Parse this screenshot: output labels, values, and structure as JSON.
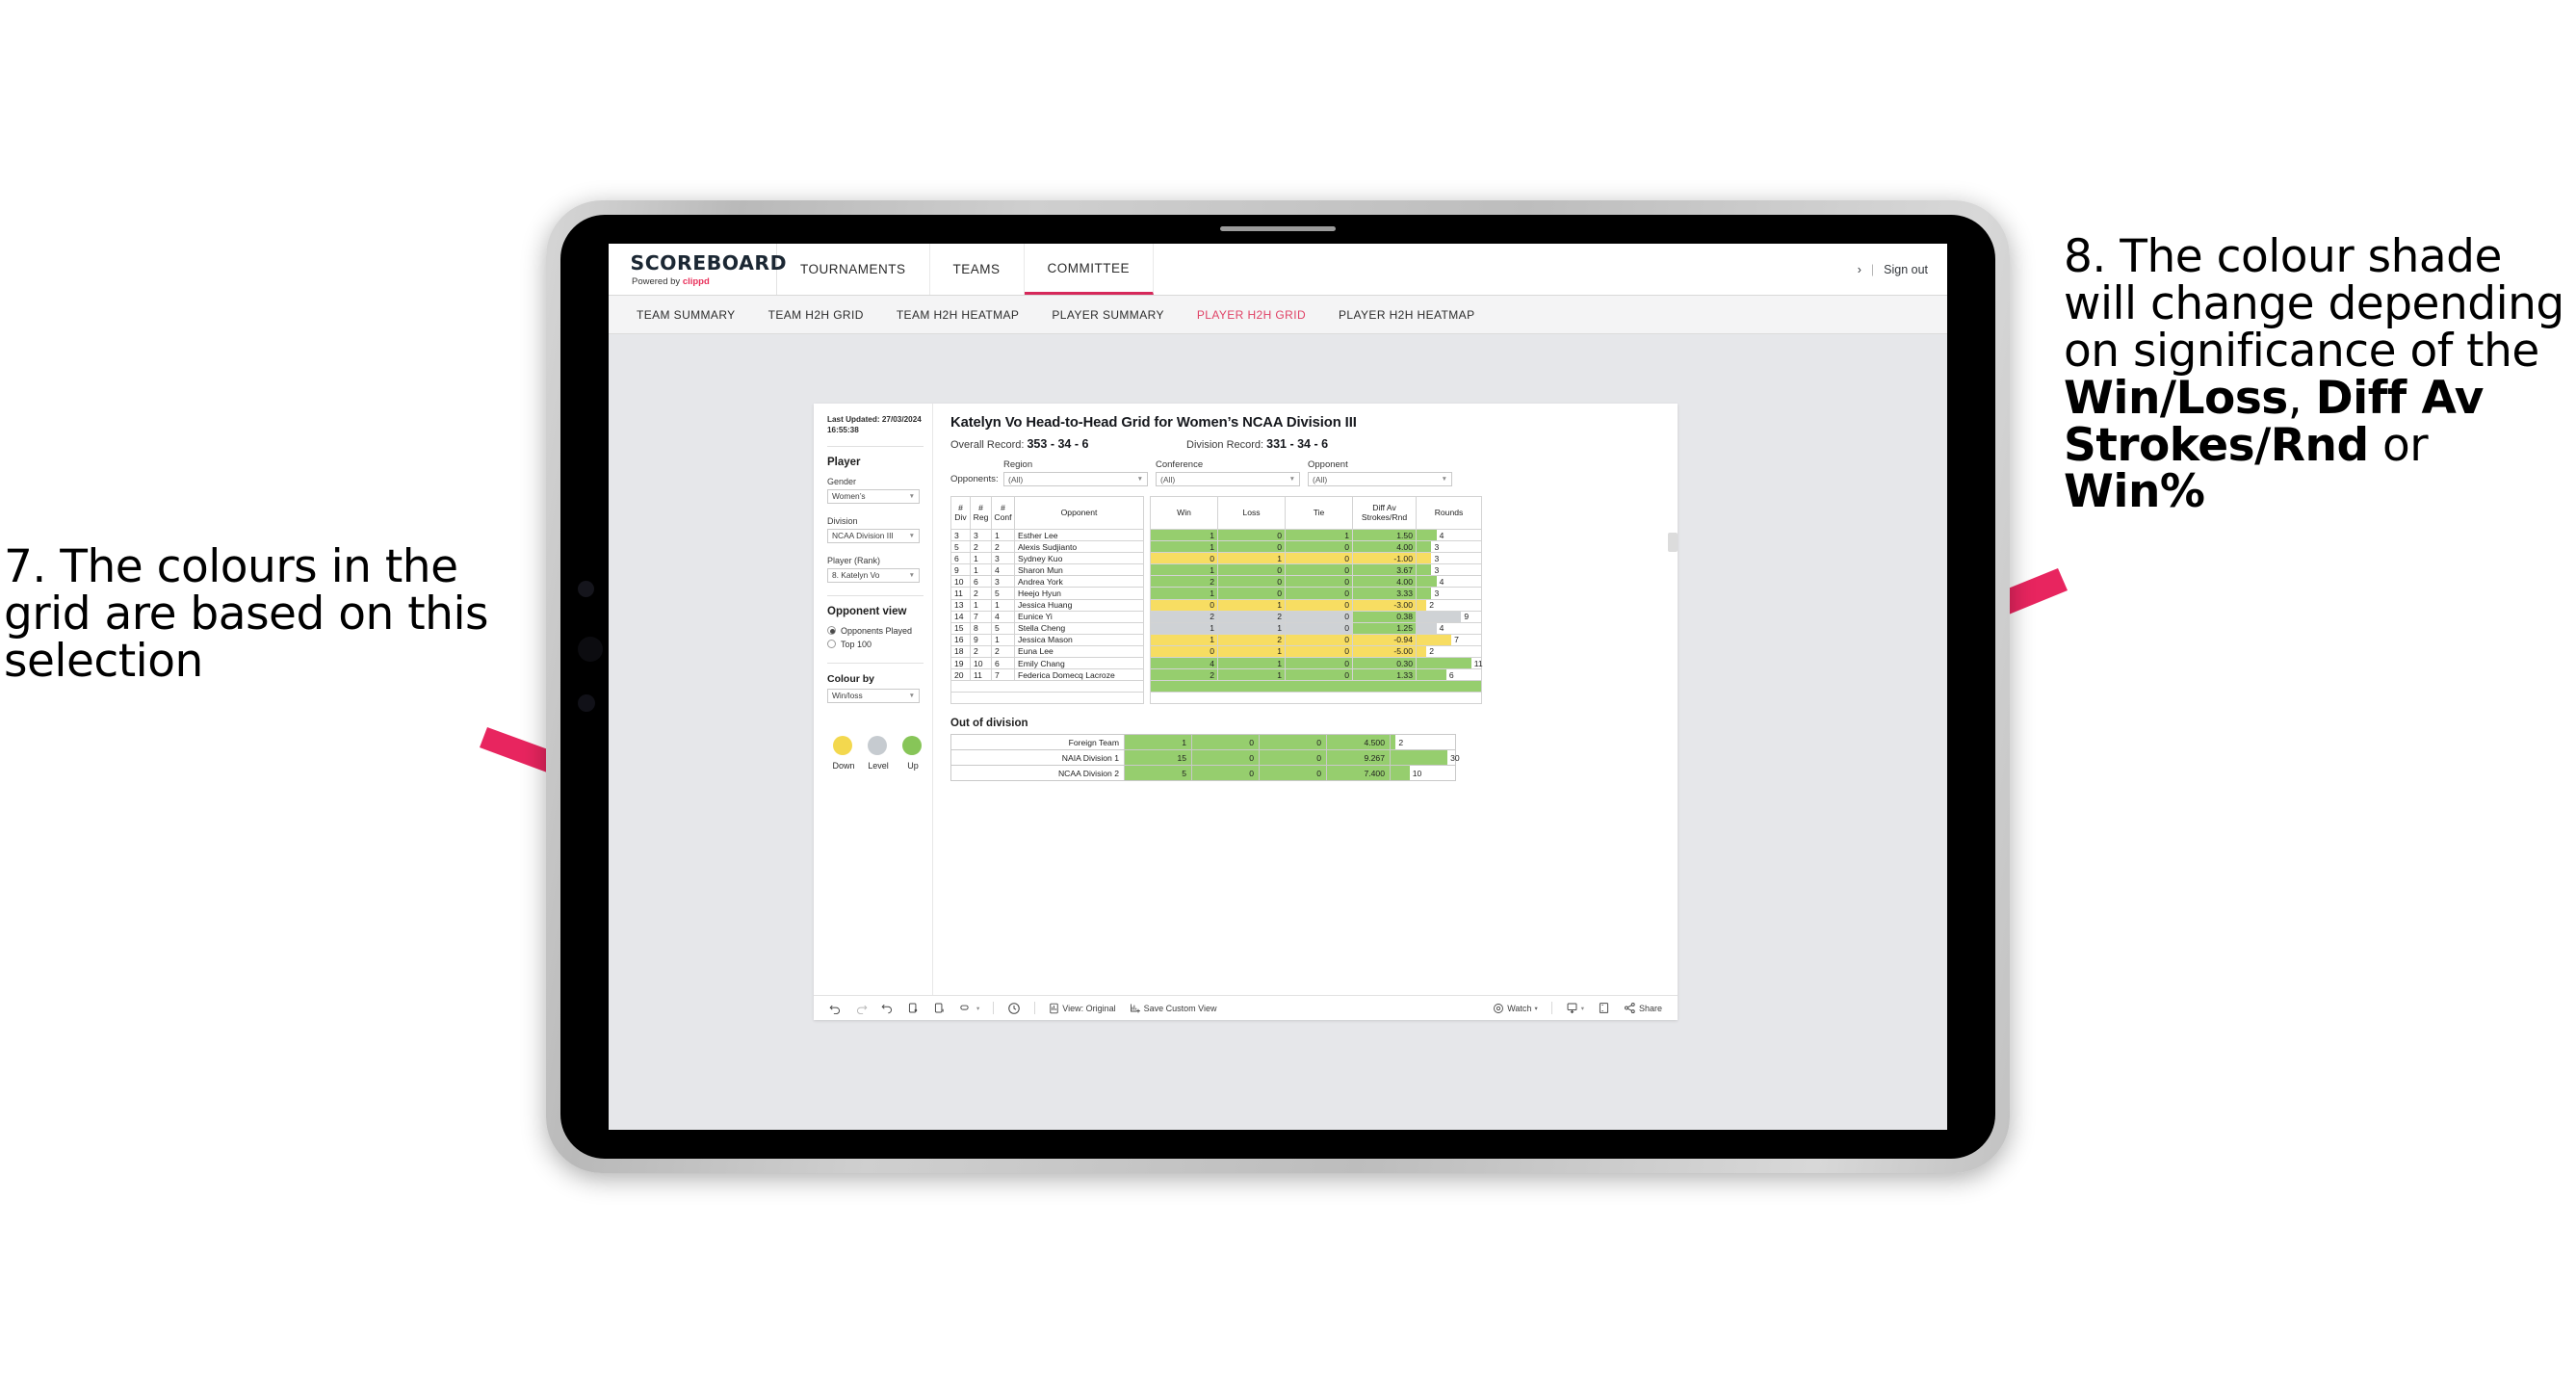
{
  "annotations": {
    "left": "7. The colours in the grid are based on this selection",
    "right_pre": "8. The colour shade will change depending on significance of the ",
    "right_b1": "Win/Loss",
    "right_mid1": ", ",
    "right_b2": "Diff Av Strokes/Rnd",
    "right_mid2": " or ",
    "right_b3": "Win%",
    "arrow_color": "#e8255f"
  },
  "app": {
    "logo": "SCOREBOARD",
    "logo_sub_prefix": "Powered by ",
    "logo_brand": "clippd",
    "top_nav": [
      {
        "label": "TOURNAMENTS",
        "active": false
      },
      {
        "label": "TEAMS",
        "active": false
      },
      {
        "label": "COMMITTEE",
        "active": true
      }
    ],
    "signout_chevron": "›",
    "signout_sep": "|",
    "signout": "Sign out",
    "sub_nav": [
      {
        "label": "TEAM SUMMARY",
        "active": false
      },
      {
        "label": "TEAM H2H GRID",
        "active": false
      },
      {
        "label": "TEAM H2H HEATMAP",
        "active": false
      },
      {
        "label": "PLAYER SUMMARY",
        "active": false
      },
      {
        "label": "PLAYER H2H GRID",
        "active": true
      },
      {
        "label": "PLAYER H2H HEATMAP",
        "active": false
      }
    ],
    "accent": "#d6285a"
  },
  "sidebar": {
    "last_updated_line1": "Last Updated: 27/03/2024",
    "last_updated_line2": "16:55:38",
    "player_heading": "Player",
    "gender_label": "Gender",
    "gender_value": "Women’s",
    "division_label": "Division",
    "division_value": "NCAA Division III",
    "player_rank_label": "Player (Rank)",
    "player_rank_value": "8. Katelyn Vo",
    "opponent_view_heading": "Opponent view",
    "opponent_view_options": [
      {
        "label": "Opponents Played",
        "selected": true
      },
      {
        "label": "Top 100",
        "selected": false
      }
    ],
    "colour_by_label": "Colour by",
    "colour_by_value": "Win/loss",
    "legend": [
      {
        "label": "Down",
        "color": "#f3d84e"
      },
      {
        "label": "Level",
        "color": "#c6cbd0"
      },
      {
        "label": "Up",
        "color": "#87c558"
      }
    ]
  },
  "panel": {
    "title": "Katelyn Vo Head-to-Head Grid for Women’s NCAA Division III",
    "overall_record_label": "Overall Record: ",
    "overall_record_value": "353 -  34 - 6",
    "division_record_label": "Division Record: ",
    "division_record_value": "331 -  34 - 6",
    "opponents_label": "Opponents:",
    "filters": [
      {
        "label": "Region",
        "value": "(All)"
      },
      {
        "label": "Conference",
        "value": "(All)"
      },
      {
        "label": "Opponent",
        "value": "(All)"
      }
    ],
    "out_of_division_title": "Out of division"
  },
  "chart_data": {
    "type": "table",
    "title": "Katelyn Vo Head-to-Head Grid for Women’s NCAA Division III",
    "columns": [
      {
        "l1": "#",
        "l2": "Div"
      },
      {
        "l1": "#",
        "l2": "Reg"
      },
      {
        "l1": "#",
        "l2": "Conf"
      },
      {
        "l1": "",
        "l2": "Opponent"
      },
      {
        "l1": "",
        "l2": "Win"
      },
      {
        "l1": "",
        "l2": "Loss"
      },
      {
        "l1": "",
        "l2": "Tie"
      },
      {
        "l1": "Diff Av",
        "l2": "Strokes/Rnd"
      },
      {
        "l1": "",
        "l2": "Rounds"
      }
    ],
    "rounds_max": 13,
    "rows": [
      {
        "div": "3",
        "reg": "3",
        "conf": "1",
        "opponent": "Esther Lee",
        "win": "1",
        "loss": "0",
        "tie": "1",
        "diff": "1.50",
        "rounds": "4",
        "color": "#96ce6e"
      },
      {
        "div": "5",
        "reg": "2",
        "conf": "2",
        "opponent": "Alexis Sudjianto",
        "win": "1",
        "loss": "0",
        "tie": "0",
        "diff": "4.00",
        "rounds": "3",
        "color": "#96ce6e"
      },
      {
        "div": "6",
        "reg": "1",
        "conf": "3",
        "opponent": "Sydney Kuo",
        "win": "0",
        "loss": "1",
        "tie": "0",
        "diff": "-1.00",
        "rounds": "3",
        "color": "#f7dd62"
      },
      {
        "div": "9",
        "reg": "1",
        "conf": "4",
        "opponent": "Sharon Mun",
        "win": "1",
        "loss": "0",
        "tie": "0",
        "diff": "3.67",
        "rounds": "3",
        "color": "#96ce6e"
      },
      {
        "div": "10",
        "reg": "6",
        "conf": "3",
        "opponent": "Andrea York",
        "win": "2",
        "loss": "0",
        "tie": "0",
        "diff": "4.00",
        "rounds": "4",
        "color": "#96ce6e"
      },
      {
        "div": "11",
        "reg": "2",
        "conf": "5",
        "opponent": "Heejo Hyun",
        "win": "1",
        "loss": "0",
        "tie": "0",
        "diff": "3.33",
        "rounds": "3",
        "color": "#96ce6e"
      },
      {
        "div": "13",
        "reg": "1",
        "conf": "1",
        "opponent": "Jessica Huang",
        "win": "0",
        "loss": "1",
        "tie": "0",
        "diff": "-3.00",
        "rounds": "2",
        "color": "#f7dd62"
      },
      {
        "div": "14",
        "reg": "7",
        "conf": "4",
        "opponent": "Eunice Yi",
        "win": "2",
        "loss": "2",
        "tie": "0",
        "diff": "0.38",
        "rounds": "9",
        "color": "#cfd2d5",
        "diff_color": "#96ce6e"
      },
      {
        "div": "15",
        "reg": "8",
        "conf": "5",
        "opponent": "Stella Cheng",
        "win": "1",
        "loss": "1",
        "tie": "0",
        "diff": "1.25",
        "rounds": "4",
        "color": "#cfd2d5",
        "diff_color": "#96ce6e"
      },
      {
        "div": "16",
        "reg": "9",
        "conf": "1",
        "opponent": "Jessica Mason",
        "win": "1",
        "loss": "2",
        "tie": "0",
        "diff": "-0.94",
        "rounds": "7",
        "color": "#f7dd62"
      },
      {
        "div": "18",
        "reg": "2",
        "conf": "2",
        "opponent": "Euna Lee",
        "win": "0",
        "loss": "1",
        "tie": "0",
        "diff": "-5.00",
        "rounds": "2",
        "color": "#f7dd62"
      },
      {
        "div": "19",
        "reg": "10",
        "conf": "6",
        "opponent": "Emily Chang",
        "win": "4",
        "loss": "1",
        "tie": "0",
        "diff": "0.30",
        "rounds": "11",
        "color": "#96ce6e"
      },
      {
        "div": "20",
        "reg": "11",
        "conf": "7",
        "opponent": "Federica Domecq Lacroze",
        "win": "2",
        "loss": "1",
        "tie": "0",
        "diff": "1.33",
        "rounds": "6",
        "color": "#96ce6e"
      }
    ],
    "out_of_division": {
      "rounds_max": 34,
      "rows": [
        {
          "name": "Foreign Team",
          "win": "1",
          "loss": "0",
          "tie": "0",
          "diff": "4.500",
          "rounds": "2",
          "color": "#96ce6e"
        },
        {
          "name": "NAIA Division 1",
          "win": "15",
          "loss": "0",
          "tie": "0",
          "diff": "9.267",
          "rounds": "30",
          "color": "#96ce6e"
        },
        {
          "name": "NCAA Division 2",
          "win": "5",
          "loss": "0",
          "tie": "0",
          "diff": "7.400",
          "rounds": "10",
          "color": "#96ce6e"
        }
      ]
    }
  },
  "toolbar": {
    "view_original": "View: Original",
    "save_custom_view": "Save Custom View",
    "watch": "Watch",
    "share": "Share",
    "caret": "▾"
  }
}
